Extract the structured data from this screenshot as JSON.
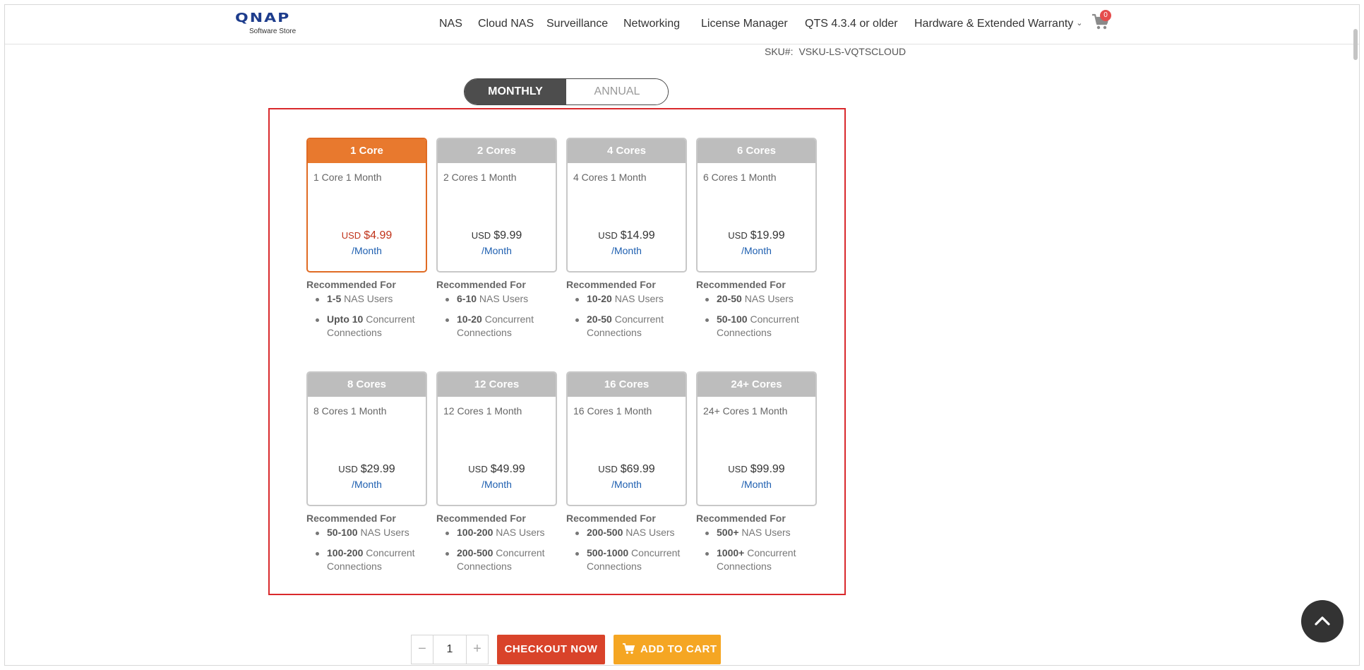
{
  "header": {
    "logo_text": "QNAP",
    "logo_subtitle": "Software Store",
    "nav": [
      {
        "label": "NAS"
      },
      {
        "label": "Cloud NAS"
      },
      {
        "label": "Surveillance"
      },
      {
        "label": "Networking"
      },
      {
        "label": "License Manager"
      },
      {
        "label": "QTS 4.3.4 or older"
      },
      {
        "label": "Hardware & Extended Warranty"
      }
    ],
    "cart_count": "0"
  },
  "sku": {
    "label": "SKU#:",
    "value": "VSKU-LS-VQTSCLOUD"
  },
  "billing_toggle": {
    "monthly": "MONTHLY",
    "annual": "ANNUAL",
    "selected": "monthly"
  },
  "plans": [
    {
      "title": "1 Core",
      "desc": "1 Core 1 Month",
      "currency": "USD",
      "price": "$4.99",
      "period": "/Month",
      "selected": true,
      "rec_title": "Recommended For",
      "users_bold": "1-5",
      "users_text": " NAS Users",
      "conn_bold": "Upto 10",
      "conn_text": " Concurrent Connections"
    },
    {
      "title": "2 Cores",
      "desc": "2 Cores 1 Month",
      "currency": "USD",
      "price": "$9.99",
      "period": "/Month",
      "selected": false,
      "rec_title": "Recommended For",
      "users_bold": "6-10",
      "users_text": " NAS Users",
      "conn_bold": "10-20",
      "conn_text": " Concurrent Connections"
    },
    {
      "title": "4 Cores",
      "desc": "4 Cores 1 Month",
      "currency": "USD",
      "price": "$14.99",
      "period": "/Month",
      "selected": false,
      "rec_title": "Recommended For",
      "users_bold": "10-20",
      "users_text": " NAS Users",
      "conn_bold": "20-50",
      "conn_text": " Concurrent Connections"
    },
    {
      "title": "6 Cores",
      "desc": "6 Cores 1 Month",
      "currency": "USD",
      "price": "$19.99",
      "period": "/Month",
      "selected": false,
      "rec_title": "Recommended For",
      "users_bold": "20-50",
      "users_text": " NAS Users",
      "conn_bold": "50-100",
      "conn_text": " Concurrent Connections"
    },
    {
      "title": "8 Cores",
      "desc": "8 Cores 1 Month",
      "currency": "USD",
      "price": "$29.99",
      "period": "/Month",
      "selected": false,
      "rec_title": "Recommended For",
      "users_bold": "50-100",
      "users_text": " NAS Users",
      "conn_bold": "100-200",
      "conn_text": " Concurrent Connections"
    },
    {
      "title": "12 Cores",
      "desc": "12 Cores 1 Month",
      "currency": "USD",
      "price": "$49.99",
      "period": "/Month",
      "selected": false,
      "rec_title": "Recommended For",
      "users_bold": "100-200",
      "users_text": " NAS Users",
      "conn_bold": "200-500",
      "conn_text": " Concurrent Connections"
    },
    {
      "title": "16 Cores",
      "desc": "16 Cores 1 Month",
      "currency": "USD",
      "price": "$69.99",
      "period": "/Month",
      "selected": false,
      "rec_title": "Recommended For",
      "users_bold": "200-500",
      "users_text": " NAS Users",
      "conn_bold": "500-1000",
      "conn_text": " Concurrent Connections"
    },
    {
      "title": "24+ Cores",
      "desc": "24+ Cores 1 Month",
      "currency": "USD",
      "price": "$99.99",
      "period": "/Month",
      "selected": false,
      "rec_title": "Recommended For",
      "users_bold": "500+",
      "users_text": " NAS Users",
      "conn_bold": "1000+",
      "conn_text": " Concurrent Connections"
    }
  ],
  "purchase": {
    "minus": "−",
    "quantity": "1",
    "plus": "+",
    "checkout_label": "CHECKOUT NOW",
    "add_to_cart_label": "ADD TO CART"
  },
  "icons": {
    "cart": "cart-icon",
    "chevron": "chevron-down-icon",
    "back_to_top": "chevron-up-icon"
  },
  "colors": {
    "brand": "#1d3c8c",
    "selected_plan": "#e8792e",
    "checkout": "#d9432a",
    "add_to_cart": "#f5a623",
    "panel_border": "#d9292c",
    "period_text": "#1e5fb0"
  }
}
